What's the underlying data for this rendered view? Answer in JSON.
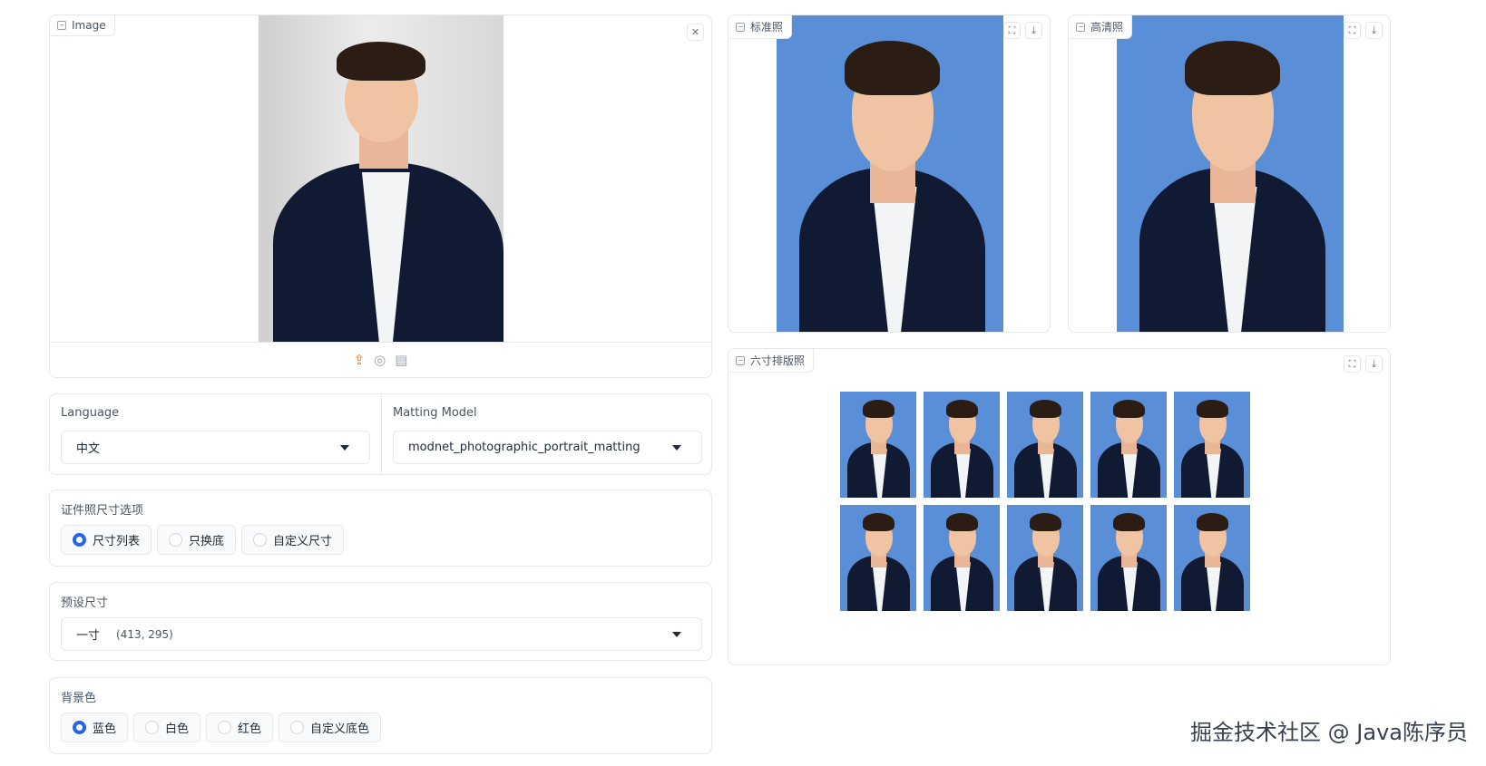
{
  "input_image": {
    "label": "Image",
    "close_icon": "close-icon",
    "upload_icons": [
      "upload-icon",
      "webcam-icon",
      "clipboard-icon"
    ]
  },
  "controls": {
    "language": {
      "label": "Language",
      "value": "中文"
    },
    "matting_model": {
      "label": "Matting Model",
      "value": "modnet_photographic_portrait_matting"
    },
    "size_options": {
      "label": "证件照尺寸选项",
      "options": [
        "尺寸列表",
        "只换底",
        "自定义尺寸"
      ],
      "selected": "尺寸列表"
    },
    "preset_size": {
      "label": "预设尺寸",
      "value": "一寸",
      "dims": "(413, 295)"
    },
    "bg_color": {
      "label": "背景色",
      "options": [
        "蓝色",
        "白色",
        "红色",
        "自定义底色"
      ],
      "selected": "蓝色"
    }
  },
  "outputs": {
    "standard": {
      "label": "标准照"
    },
    "hd": {
      "label": "高清照"
    },
    "layout": {
      "label": "六寸排版照",
      "count": 10
    }
  },
  "colors": {
    "photo_blue": "#5a8ed6",
    "accent": "#2563eb",
    "upload_orange": "#f97316"
  },
  "watermark": "掘金技术社区 @ Java陈序员"
}
